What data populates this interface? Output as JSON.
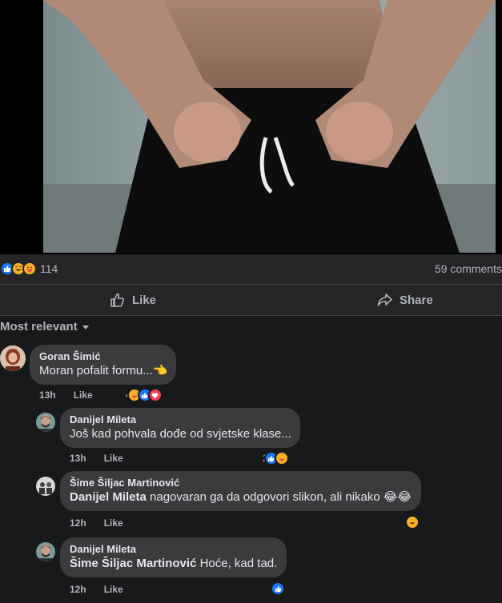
{
  "post": {
    "reaction_count": "114",
    "comment_count": "59 comments"
  },
  "actions": {
    "like": "Like",
    "share": "Share"
  },
  "sort": {
    "label": "Most relevant"
  },
  "comments": [
    {
      "author": "Goran Šimić",
      "text": "Moran pofalit formu...👈",
      "time": "13h",
      "like": "Like",
      "reaction_count": "4"
    },
    {
      "author": "Danijel Mileta",
      "text": "Još kad pohvala dođe od svjetske klase...",
      "time": "13h",
      "like": "Like",
      "reaction_count": "2"
    },
    {
      "author": "Šime Šiljac Martinović",
      "mention": "Danijel Mileta",
      "text": " nagovaran ga da odgovori slikon, ali nikako 😂😂",
      "time": "12h",
      "like": "Like"
    },
    {
      "author": "Danijel Mileta",
      "mention": "Šime Šiljac Martinović",
      "text": " Hoće, kad tad.",
      "time": "12h",
      "like": "Like"
    }
  ]
}
